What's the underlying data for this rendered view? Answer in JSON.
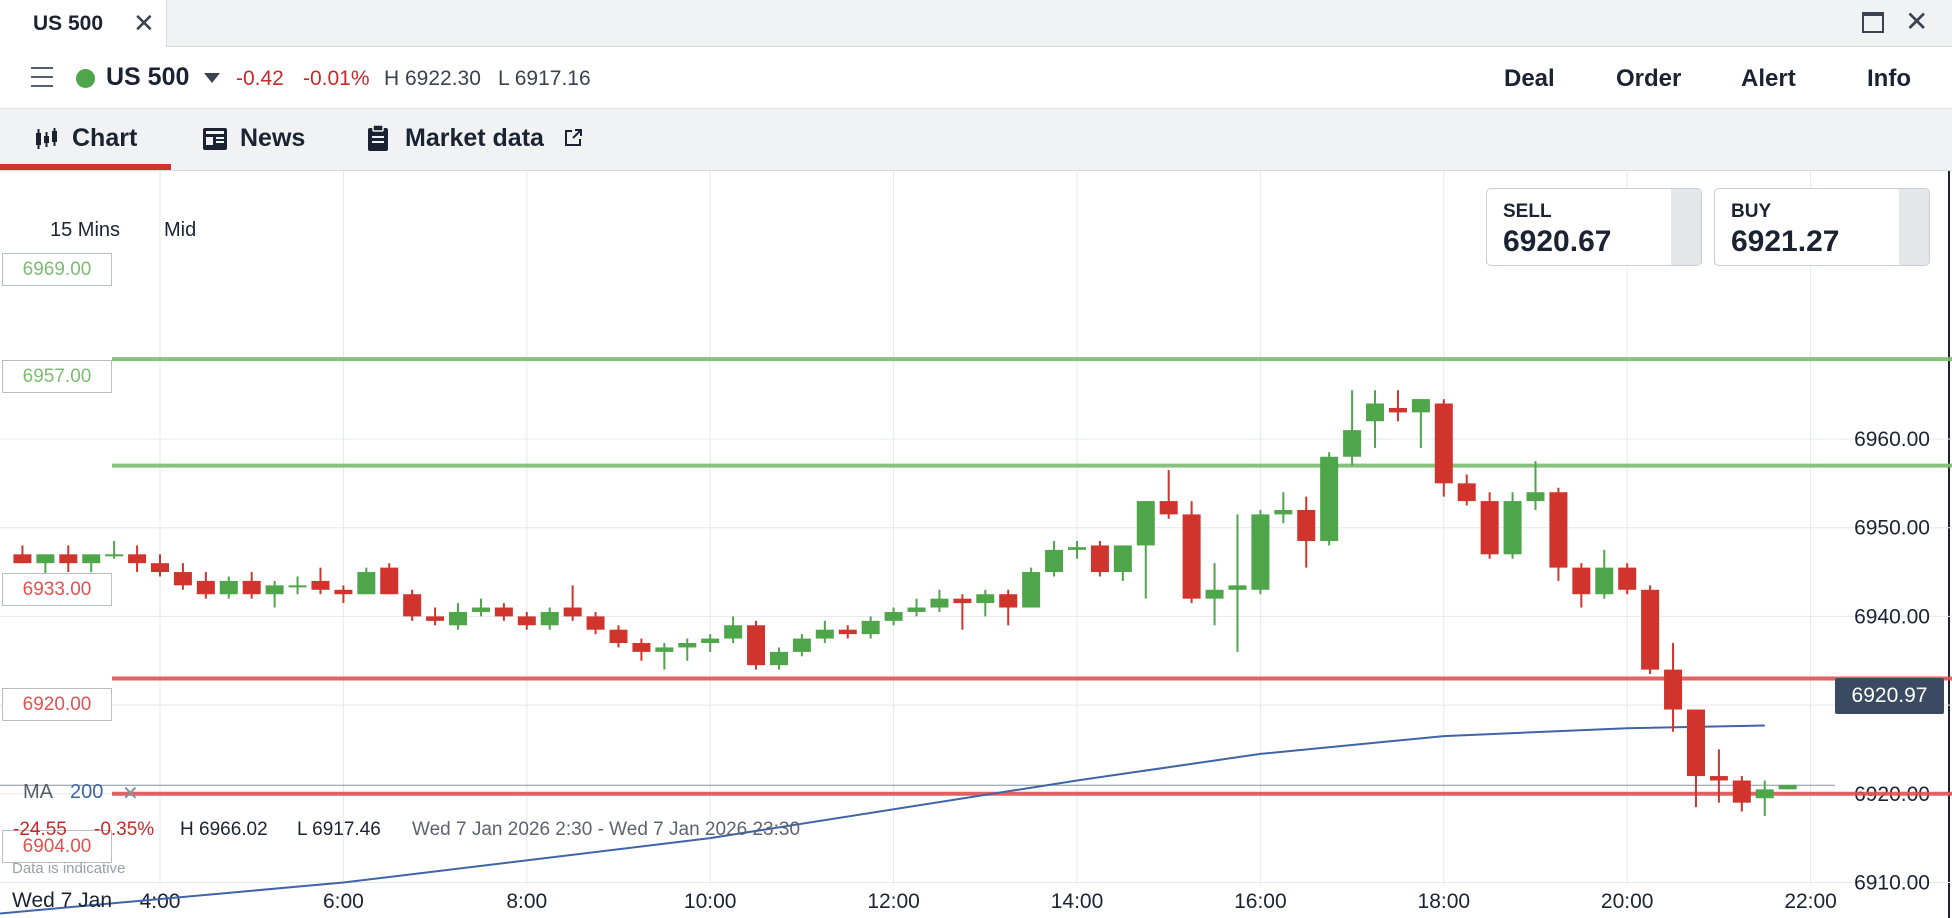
{
  "window": {
    "tab_title": "US 500",
    "close_glyph": "✕"
  },
  "header": {
    "symbol": "US 500",
    "change": "-0.42",
    "change_pct": "-0.01%",
    "high": "H 6922.30",
    "low": "L 6917.16",
    "actions": [
      "Deal",
      "Order",
      "Alert",
      "Info"
    ]
  },
  "tabs": [
    {
      "label": "Chart",
      "icon": "candlestick-icon",
      "active": true
    },
    {
      "label": "News",
      "icon": "newspaper-icon"
    },
    {
      "label": "Market data",
      "icon": "clipboard-icon"
    }
  ],
  "ticket": {
    "sell_label": "SELL",
    "sell_price": "6920.67",
    "buy_label": "BUY",
    "buy_price": "6921.27"
  },
  "chart_settings": {
    "timeframe": "15 Mins",
    "price_type": "Mid"
  },
  "levels": [
    {
      "label": "6969.00",
      "price": 6969,
      "color": "#7cbd70"
    },
    {
      "label": "6957.00",
      "price": 6957,
      "color": "#7cbd70"
    },
    {
      "label": "6933.00",
      "price": 6933,
      "color": "#e05252"
    },
    {
      "label": "6920.00",
      "price": 6920,
      "color": "#e05252"
    },
    {
      "label": "6904.00",
      "price": 6904,
      "color": "#e05252"
    }
  ],
  "indicator": {
    "name": "MA",
    "period": "200",
    "remove": "✕"
  },
  "stats": {
    "change": "-24.55",
    "change_pct": "-0.35%",
    "high": "H 6966.02",
    "low": "L 6917.46",
    "range": "Wed 7 Jan 2026 2:30 - Wed 7 Jan 2026 23:30"
  },
  "disclaimer": "Data is indicative",
  "date_label": "Wed 7 Jan",
  "current_price": "6920.97",
  "colors": {
    "up": "#4ea54a",
    "down": "#d0342c",
    "ma": "#3f64a8",
    "grid": "#e6e8ec"
  },
  "chart_data": {
    "type": "candlestick",
    "timeframe": "15 Mins",
    "y_ticks": [
      "6910.00",
      "6920.00",
      "6930.00",
      "6940.00",
      "6950.00",
      "6960.00"
    ],
    "y_range": [
      6904,
      6971
    ],
    "x_ticks": [
      "4:00",
      "6:00",
      "8:00",
      "10:00",
      "12:00",
      "14:00",
      "16:00",
      "18:00",
      "20:00",
      "22:00"
    ],
    "x_range_hours": [
      2.25,
      23.25
    ],
    "ma_period": 200,
    "ma": [
      [
        2.25,
        6906.5
      ],
      [
        6,
        6910
      ],
      [
        10,
        6915
      ],
      [
        14,
        6921.5
      ],
      [
        16,
        6924.5
      ],
      [
        18,
        6926.5
      ],
      [
        20,
        6927.4
      ],
      [
        21.5,
        6927.7
      ]
    ],
    "candles": [
      {
        "t": 2.5,
        "o": 6947,
        "h": 6948,
        "l": 6946,
        "c": 6946
      },
      {
        "t": 2.75,
        "o": 6946,
        "h": 6947,
        "l": 6944.5,
        "c": 6947
      },
      {
        "t": 3.0,
        "o": 6947,
        "h": 6948,
        "l": 6945,
        "c": 6946
      },
      {
        "t": 3.25,
        "o": 6946,
        "h": 6947,
        "l": 6945,
        "c": 6947
      },
      {
        "t": 3.5,
        "o": 6947,
        "h": 6948.5,
        "l": 6946.5,
        "c": 6947
      },
      {
        "t": 3.75,
        "o": 6947,
        "h": 6948,
        "l": 6945,
        "c": 6946
      },
      {
        "t": 4.0,
        "o": 6946,
        "h": 6947,
        "l": 6944.5,
        "c": 6945
      },
      {
        "t": 4.25,
        "o": 6945,
        "h": 6946,
        "l": 6943,
        "c": 6943.5
      },
      {
        "t": 4.5,
        "o": 6944,
        "h": 6945,
        "l": 6942,
        "c": 6942.5
      },
      {
        "t": 4.75,
        "o": 6942.5,
        "h": 6944.5,
        "l": 6942,
        "c": 6944
      },
      {
        "t": 5.0,
        "o": 6944,
        "h": 6945,
        "l": 6942,
        "c": 6942.5
      },
      {
        "t": 5.25,
        "o": 6942.5,
        "h": 6944,
        "l": 6941,
        "c": 6943.5
      },
      {
        "t": 5.5,
        "o": 6943.5,
        "h": 6944.5,
        "l": 6942.5,
        "c": 6943.5
      },
      {
        "t": 5.75,
        "o": 6944,
        "h": 6945.5,
        "l": 6942.5,
        "c": 6943
      },
      {
        "t": 6.0,
        "o": 6943,
        "h": 6943.5,
        "l": 6941.5,
        "c": 6942.5
      },
      {
        "t": 6.25,
        "o": 6942.5,
        "h": 6945.5,
        "l": 6942.5,
        "c": 6945
      },
      {
        "t": 6.5,
        "o": 6945.5,
        "h": 6946,
        "l": 6942.5,
        "c": 6942.5
      },
      {
        "t": 6.75,
        "o": 6942.5,
        "h": 6943,
        "l": 6939.5,
        "c": 6940
      },
      {
        "t": 7.0,
        "o": 6940,
        "h": 6941,
        "l": 6939,
        "c": 6939.5
      },
      {
        "t": 7.25,
        "o": 6939,
        "h": 6941.5,
        "l": 6938.5,
        "c": 6940.5
      },
      {
        "t": 7.5,
        "o": 6940.5,
        "h": 6942,
        "l": 6940,
        "c": 6941
      },
      {
        "t": 7.75,
        "o": 6941,
        "h": 6941.5,
        "l": 6939.5,
        "c": 6940
      },
      {
        "t": 8.0,
        "o": 6940,
        "h": 6940.5,
        "l": 6938.5,
        "c": 6939
      },
      {
        "t": 8.25,
        "o": 6939,
        "h": 6941,
        "l": 6938.5,
        "c": 6940.5
      },
      {
        "t": 8.5,
        "o": 6941,
        "h": 6943.5,
        "l": 6939.5,
        "c": 6940
      },
      {
        "t": 8.75,
        "o": 6940,
        "h": 6940.5,
        "l": 6938,
        "c": 6938.5
      },
      {
        "t": 9.0,
        "o": 6938.5,
        "h": 6939,
        "l": 6936.5,
        "c": 6937
      },
      {
        "t": 9.25,
        "o": 6937,
        "h": 6937.5,
        "l": 6935,
        "c": 6936
      },
      {
        "t": 9.5,
        "o": 6936,
        "h": 6937,
        "l": 6934,
        "c": 6936.5
      },
      {
        "t": 9.75,
        "o": 6936.5,
        "h": 6937.5,
        "l": 6935,
        "c": 6937
      },
      {
        "t": 10.0,
        "o": 6937,
        "h": 6938,
        "l": 6936,
        "c": 6937.5
      },
      {
        "t": 10.25,
        "o": 6937.5,
        "h": 6940,
        "l": 6937,
        "c": 6939
      },
      {
        "t": 10.5,
        "o": 6939,
        "h": 6939.5,
        "l": 6934,
        "c": 6934.5
      },
      {
        "t": 10.75,
        "o": 6934.5,
        "h": 6936.5,
        "l": 6934,
        "c": 6936
      },
      {
        "t": 11.0,
        "o": 6936,
        "h": 6938,
        "l": 6935.5,
        "c": 6937.5
      },
      {
        "t": 11.25,
        "o": 6937.5,
        "h": 6939.5,
        "l": 6937,
        "c": 6938.5
      },
      {
        "t": 11.5,
        "o": 6938.5,
        "h": 6939,
        "l": 6937.5,
        "c": 6938
      },
      {
        "t": 11.75,
        "o": 6938,
        "h": 6940,
        "l": 6937.5,
        "c": 6939.5
      },
      {
        "t": 12.0,
        "o": 6939.5,
        "h": 6941,
        "l": 6939,
        "c": 6940.5
      },
      {
        "t": 12.25,
        "o": 6940.5,
        "h": 6942,
        "l": 6940,
        "c": 6941
      },
      {
        "t": 12.5,
        "o": 6941,
        "h": 6943,
        "l": 6940.5,
        "c": 6942
      },
      {
        "t": 12.75,
        "o": 6942,
        "h": 6942.5,
        "l": 6938.5,
        "c": 6941.5
      },
      {
        "t": 13.0,
        "o": 6941.5,
        "h": 6943,
        "l": 6940,
        "c": 6942.5
      },
      {
        "t": 13.25,
        "o": 6942.5,
        "h": 6943,
        "l": 6939,
        "c": 6941
      },
      {
        "t": 13.5,
        "o": 6941,
        "h": 6945.5,
        "l": 6941,
        "c": 6945
      },
      {
        "t": 13.75,
        "o": 6945,
        "h": 6948.5,
        "l": 6944.5,
        "c": 6947.5
      },
      {
        "t": 14.0,
        "o": 6947.5,
        "h": 6948.5,
        "l": 6946.5,
        "c": 6947.8
      },
      {
        "t": 14.25,
        "o": 6948,
        "h": 6948.5,
        "l": 6944.5,
        "c": 6945
      },
      {
        "t": 14.5,
        "o": 6945,
        "h": 6948,
        "l": 6944,
        "c": 6948
      },
      {
        "t": 14.75,
        "o": 6948,
        "h": 6953,
        "l": 6942,
        "c": 6953
      },
      {
        "t": 15.0,
        "o": 6953,
        "h": 6956.5,
        "l": 6951,
        "c": 6951.5
      },
      {
        "t": 15.25,
        "o": 6951.5,
        "h": 6953,
        "l": 6941.5,
        "c": 6942
      },
      {
        "t": 15.5,
        "o": 6942,
        "h": 6946,
        "l": 6939,
        "c": 6943
      },
      {
        "t": 15.75,
        "o": 6943,
        "h": 6951.5,
        "l": 6936,
        "c": 6943.5
      },
      {
        "t": 16.0,
        "o": 6943,
        "h": 6952,
        "l": 6942.5,
        "c": 6951.5
      },
      {
        "t": 16.25,
        "o": 6951.5,
        "h": 6954,
        "l": 6950.5,
        "c": 6952
      },
      {
        "t": 16.5,
        "o": 6952,
        "h": 6953.5,
        "l": 6945.5,
        "c": 6948.5
      },
      {
        "t": 16.75,
        "o": 6948.5,
        "h": 6958.5,
        "l": 6948,
        "c": 6958
      },
      {
        "t": 17.0,
        "o": 6958,
        "h": 6965.5,
        "l": 6957,
        "c": 6961
      },
      {
        "t": 17.25,
        "o": 6962,
        "h": 6965.5,
        "l": 6959,
        "c": 6964
      },
      {
        "t": 17.5,
        "o": 6963.5,
        "h": 6965.5,
        "l": 6962,
        "c": 6963
      },
      {
        "t": 17.75,
        "o": 6963,
        "h": 6964.5,
        "l": 6959,
        "c": 6964.5
      },
      {
        "t": 18.0,
        "o": 6964,
        "h": 6964.5,
        "l": 6953.5,
        "c": 6955
      },
      {
        "t": 18.25,
        "o": 6955,
        "h": 6956,
        "l": 6952.5,
        "c": 6953
      },
      {
        "t": 18.5,
        "o": 6953,
        "h": 6954,
        "l": 6946.5,
        "c": 6947
      },
      {
        "t": 18.75,
        "o": 6947,
        "h": 6954,
        "l": 6946.5,
        "c": 6953
      },
      {
        "t": 19.0,
        "o": 6953,
        "h": 6957.5,
        "l": 6952,
        "c": 6954
      },
      {
        "t": 19.25,
        "o": 6954,
        "h": 6954.5,
        "l": 6944,
        "c": 6945.5
      },
      {
        "t": 19.5,
        "o": 6945.5,
        "h": 6946,
        "l": 6941,
        "c": 6942.5
      },
      {
        "t": 19.75,
        "o": 6942.5,
        "h": 6947.5,
        "l": 6942,
        "c": 6945.5
      },
      {
        "t": 20.0,
        "o": 6945.5,
        "h": 6946,
        "l": 6942.5,
        "c": 6943
      },
      {
        "t": 20.25,
        "o": 6943,
        "h": 6943.5,
        "l": 6933.5,
        "c": 6934
      },
      {
        "t": 20.5,
        "o": 6934,
        "h": 6937,
        "l": 6927,
        "c": 6929.5
      },
      {
        "t": 20.75,
        "o": 6929.5,
        "h": 6929.5,
        "l": 6918.5,
        "c": 6922
      },
      {
        "t": 21.0,
        "o": 6922,
        "h": 6925,
        "l": 6919,
        "c": 6921.5
      },
      {
        "t": 21.25,
        "o": 6921.5,
        "h": 6922,
        "l": 6918,
        "c": 6919
      },
      {
        "t": 21.5,
        "o": 6919.5,
        "h": 6921.5,
        "l": 6917.5,
        "c": 6920.5
      },
      {
        "t": 21.75,
        "o": 6920.5,
        "h": 6921,
        "l": 6920.5,
        "c": 6921
      }
    ]
  }
}
